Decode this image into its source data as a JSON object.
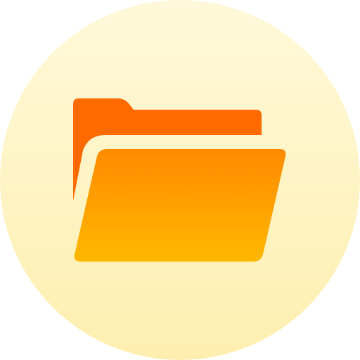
{
  "icon": {
    "name": "folder-open-icon",
    "colors": {
      "background_top": "#FFF9DA",
      "background_bottom": "#FEEFB0",
      "folder_back": "#FF6A00",
      "folder_front_top": "#FF8A00",
      "folder_front_bottom": "#FFB800",
      "separator": "#FFF7D6"
    }
  }
}
